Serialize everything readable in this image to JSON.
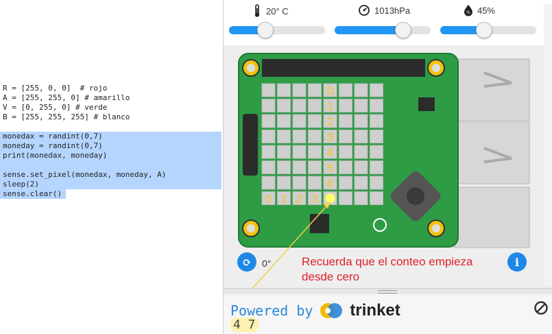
{
  "code": {
    "lines1": [
      {
        "t": "R = [255, 0, 0]  # rojo"
      },
      {
        "t": "A = [255, 255, 0] # amarillo"
      },
      {
        "t": "V = [0, 255, 0] # verde"
      },
      {
        "t": "B = [255, 255, 255] # blanco"
      }
    ],
    "lines2": [
      "monedax = randint(0,7)",
      "moneday = randint(0,7)",
      "print(monedax, moneday)",
      "",
      "sense.set_pixel(monedax, moneday, A)",
      "sleep(2)",
      "sense.clear()"
    ]
  },
  "sensors": {
    "temperature": {
      "label": "20° C",
      "icon": "thermometer-icon",
      "level": 0.37
    },
    "pressure": {
      "label": "1013hPa",
      "icon": "gauge-icon",
      "level": 0.71
    },
    "humidity": {
      "label": "45%",
      "icon": "humidity-icon",
      "level": 0.45
    }
  },
  "board": {
    "col_labels": [
      "0",
      "1",
      "2",
      "3"
    ],
    "row_labels": [
      "0",
      "1",
      "2",
      "3",
      "4",
      "5",
      "6"
    ],
    "lit_pixel": {
      "x": 4,
      "y": 7,
      "color": "#ffff66"
    }
  },
  "rotation": {
    "label": "0°"
  },
  "annotation": {
    "line1": "Recuerda que el conteo empieza",
    "line2": "desde cero"
  },
  "output": {
    "powered_by": "Powered by",
    "brand": "trinket",
    "text": "4 7"
  },
  "colors": {
    "accent": "#1e88e5",
    "board": "#2e9b45",
    "annotation": "#e0202a"
  }
}
